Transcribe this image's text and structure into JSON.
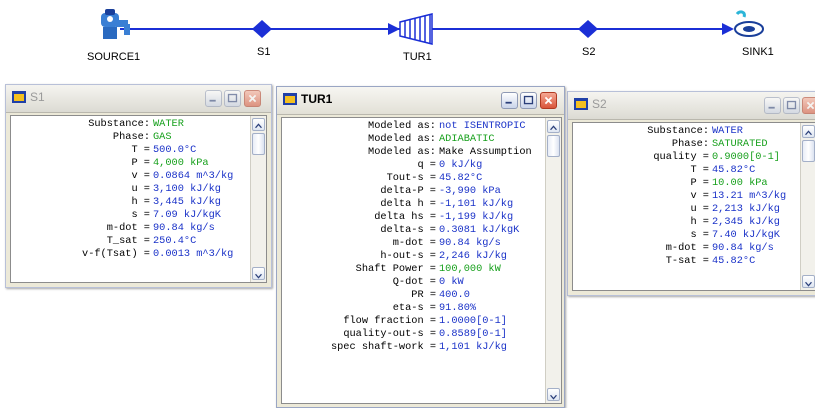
{
  "flowsheet": {
    "nodes": [
      {
        "id": "source1",
        "label": "SOURCE1"
      },
      {
        "id": "s1",
        "label": "S1"
      },
      {
        "id": "tur1",
        "label": "TUR1"
      },
      {
        "id": "s2",
        "label": "S2"
      },
      {
        "id": "sink1",
        "label": "SINK1"
      }
    ]
  },
  "windows": {
    "s1": {
      "title": "S1",
      "rows": [
        {
          "label": "Substance:",
          "value": "WATER",
          "color": "green"
        },
        {
          "label": "Phase:",
          "value": "GAS",
          "color": "green"
        },
        {
          "label": "T =",
          "value": "500.0°C",
          "color": "blue"
        },
        {
          "label": "P =",
          "value": "4,000 kPa",
          "color": "green"
        },
        {
          "label": "v =",
          "value": "0.0864 m^3/kg",
          "color": "blue"
        },
        {
          "label": "u =",
          "value": "3,100 kJ/kg",
          "color": "blue"
        },
        {
          "label": "h =",
          "value": "3,445 kJ/kg",
          "color": "blue"
        },
        {
          "label": "s =",
          "value": "7.09 kJ/kgK",
          "color": "blue"
        },
        {
          "label": "m-dot =",
          "value": "90.84 kg/s",
          "color": "blue"
        },
        {
          "label": "T_sat =",
          "value": "250.4°C",
          "color": "blue"
        },
        {
          "label": "v-f(Tsat) =",
          "value": "0.0013 m^3/kg",
          "color": "blue"
        }
      ]
    },
    "tur1": {
      "title": "TUR1",
      "rows": [
        {
          "label": "Modeled as:",
          "value": "not ISENTROPIC",
          "color": "blue"
        },
        {
          "label": "Modeled as:",
          "value": "ADIABATIC",
          "color": "green"
        },
        {
          "label": "Modeled as:",
          "value": "Make Assumption",
          "color": "black"
        },
        {
          "label": "q =",
          "value": "0 kJ/kg",
          "color": "blue"
        },
        {
          "label": "Tout-s =",
          "value": "45.82°C",
          "color": "blue"
        },
        {
          "label": "delta-P =",
          "value": "-3,990 kPa",
          "color": "blue"
        },
        {
          "label": "delta h =",
          "value": "-1,101 kJ/kg",
          "color": "blue"
        },
        {
          "label": "delta hs =",
          "value": "-1,199 kJ/kg",
          "color": "blue"
        },
        {
          "label": "delta-s =",
          "value": "0.3081 kJ/kgK",
          "color": "blue"
        },
        {
          "label": "m-dot =",
          "value": "90.84 kg/s",
          "color": "blue"
        },
        {
          "label": "h-out-s =",
          "value": "2,246 kJ/kg",
          "color": "blue"
        },
        {
          "label": "Shaft Power =",
          "value": "100,000 kW",
          "color": "green"
        },
        {
          "label": "Q-dot =",
          "value": "0 kW",
          "color": "blue"
        },
        {
          "label": "PR =",
          "value": "400.0",
          "color": "blue"
        },
        {
          "label": "eta-s =",
          "value": "91.80%",
          "color": "blue"
        },
        {
          "label": "flow fraction =",
          "value": "1.0000[0-1]",
          "color": "blue"
        },
        {
          "label": "quality-out-s =",
          "value": "0.8589[0-1]",
          "color": "blue"
        },
        {
          "label": "spec shaft-work =",
          "value": "1,101 kJ/kg",
          "color": "blue"
        }
      ]
    },
    "s2": {
      "title": "S2",
      "rows": [
        {
          "label": "Substance:",
          "value": "WATER",
          "color": "blue"
        },
        {
          "label": "Phase:",
          "value": "SATURATED",
          "color": "green"
        },
        {
          "label": "quality =",
          "value": "0.9000[0-1]",
          "color": "green"
        },
        {
          "label": "T =",
          "value": "45.82°C",
          "color": "blue"
        },
        {
          "label": "P =",
          "value": "10.00 kPa",
          "color": "green"
        },
        {
          "label": "v =",
          "value": "13.21 m^3/kg",
          "color": "blue"
        },
        {
          "label": "u =",
          "value": "2,213 kJ/kg",
          "color": "blue"
        },
        {
          "label": "h =",
          "value": "2,345 kJ/kg",
          "color": "blue"
        },
        {
          "label": "s =",
          "value": "7.40 kJ/kgK",
          "color": "blue"
        },
        {
          "label": "m-dot =",
          "value": "90.84 kg/s",
          "color": "blue"
        },
        {
          "label": "T-sat =",
          "value": "45.82°C",
          "color": "blue"
        }
      ]
    }
  },
  "colors": {
    "blue": "#1a32c8",
    "green": "#17a01c",
    "link": "#1b2fd6"
  }
}
